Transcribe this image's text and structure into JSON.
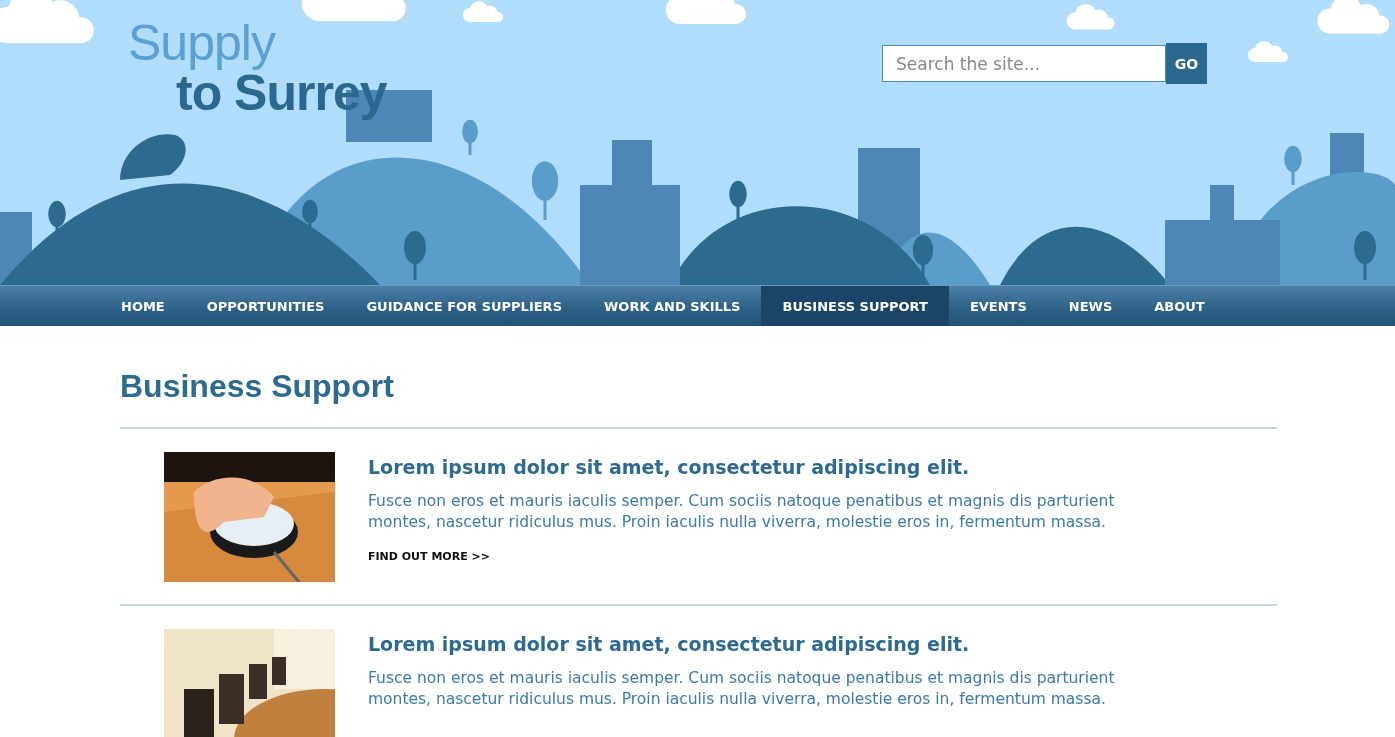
{
  "logo": {
    "line_1": "Supply",
    "line_2": "to Surrey"
  },
  "search": {
    "placeholder": "Search the site...",
    "button": "GO"
  },
  "nav": [
    {
      "label": "HOME",
      "selected": false
    },
    {
      "label": "OPPORTUNITIES",
      "selected": false
    },
    {
      "label": "GUIDANCE FOR SUPPLIERS",
      "selected": false
    },
    {
      "label": "WORK AND SKILLS",
      "selected": false
    },
    {
      "label": "BUSINESS SUPPORT",
      "selected": true
    },
    {
      "label": "EVENTS",
      "selected": false
    },
    {
      "label": "NEWS",
      "selected": false
    },
    {
      "label": "ABOUT",
      "selected": false
    }
  ],
  "page_title": "Business Support",
  "articles": [
    {
      "title": "Lorem ipsum dolor sit amet, consectetur adipiscing elit.",
      "body": "Fusce non eros et mauris iaculis semper. Cum sociis natoque penatibus et magnis dis parturient montes, nascetur ridiculus mus. Proin iaculis nulla viverra, molestie eros in, fermentum massa.",
      "link": "FIND OUT MORE >>"
    },
    {
      "title": "Lorem ipsum dolor sit amet, consectetur adipiscing elit.",
      "body": "Fusce non eros et mauris iaculis semper. Cum sociis natoque penatibus et magnis dis parturient montes, nascetur ridiculus mus. Proin iaculis nulla viverra, molestie eros in, fermentum massa."
    }
  ]
}
